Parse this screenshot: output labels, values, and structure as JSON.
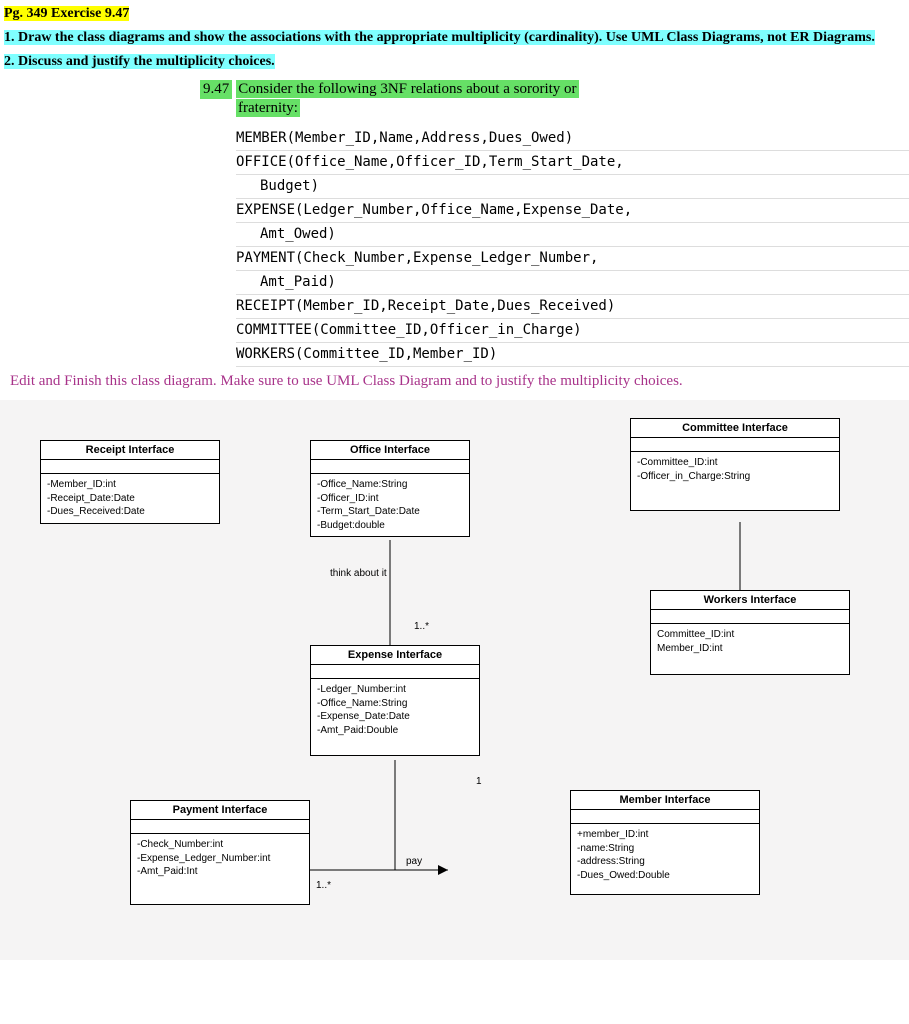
{
  "header": {
    "page_ref": "Pg. 349 Exercise 9.47",
    "instruction1": "1. Draw the class diagrams and show the associations with the appropriate multiplicity (cardinality).  Use UML Class Diagrams, not ER Diagrams.",
    "instruction2": "2. Discuss and justify the multiplicity choices."
  },
  "problem": {
    "number": "9.47",
    "title_line1": "Consider the following 3NF relations about a sorority or",
    "title_line2": "fraternity:",
    "relations": [
      "MEMBER(Member_ID,Name,Address,Dues_Owed)",
      "OFFICE(Office_Name,Officer_ID,Term_Start_Date,",
      "    Budget)",
      "EXPENSE(Ledger_Number,Office_Name,Expense_Date,",
      "    Amt_Owed)",
      "PAYMENT(Check_Number,Expense_Ledger_Number,",
      "    Amt_Paid)",
      "RECEIPT(Member_ID,Receipt_Date,Dues_Received)",
      "COMMITTEE(Committee_ID,Officer_in_Charge)",
      "WORKERS(Committee_ID,Member_ID)"
    ]
  },
  "handwritten": "Edit and Finish this class diagram. Make sure to use UML Class Diagram and to justify the multiplicity choices.",
  "diagram": {
    "boxes": {
      "receipt": {
        "title": "Receipt Interface",
        "attrs": [
          "-Member_ID:int",
          "-Receipt_Date:Date",
          "-Dues_Received:Date"
        ]
      },
      "office": {
        "title": "Office Interface",
        "attrs": [
          "-Office_Name:String",
          "-Officer_ID:int",
          "-Term_Start_Date:Date",
          "-Budget:double"
        ]
      },
      "committee": {
        "title": "Committee Interface",
        "attrs": [
          "-Committee_ID:int",
          "-Officer_in_Charge:String"
        ]
      },
      "workers": {
        "title": "Workers Interface",
        "attrs": [
          "Committee_ID:int",
          "Member_ID:int"
        ]
      },
      "expense": {
        "title": "Expense Interface",
        "attrs": [
          "-Ledger_Number:int",
          "-Office_Name:String",
          "-Expense_Date:Date",
          "-Amt_Paid:Double"
        ]
      },
      "payment": {
        "title": "Payment Interface",
        "attrs": [
          "-Check_Number:int",
          "-Expense_Ledger_Number:int",
          "-Amt_Paid:Int"
        ]
      },
      "member": {
        "title": "Member Interface",
        "attrs": [
          "+member_ID:int",
          "-name:String",
          "-address:String",
          "-Dues_Owed:Double"
        ]
      }
    },
    "labels": {
      "think": "think about it",
      "m_top": "1..*",
      "m_one": "1",
      "m_bottom": "1..*",
      "pay": "pay"
    }
  }
}
